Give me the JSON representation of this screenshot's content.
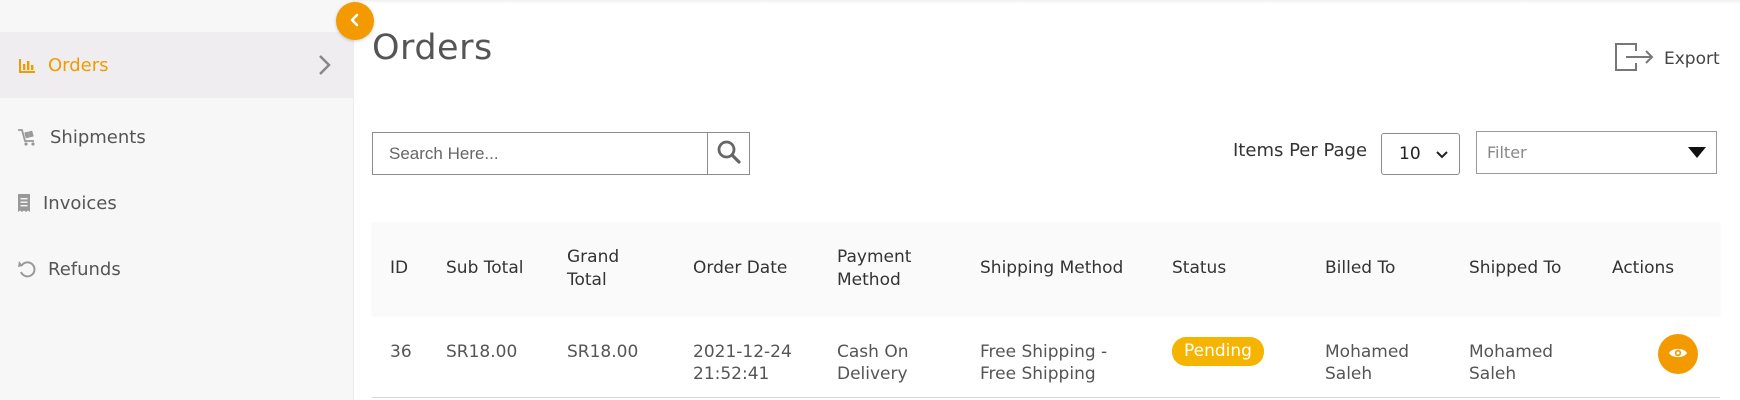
{
  "colors": {
    "accent": "#f29a00",
    "badge": "#f5b400"
  },
  "sidebar": {
    "items": [
      {
        "label": "Orders",
        "icon": "bar-chart-icon",
        "active": true
      },
      {
        "label": "Shipments",
        "icon": "cart-icon",
        "active": false
      },
      {
        "label": "Invoices",
        "icon": "receipt-icon",
        "active": false
      },
      {
        "label": "Refunds",
        "icon": "undo-icon",
        "active": false
      }
    ],
    "collapse_icon": "chevron-left-icon"
  },
  "header": {
    "title": "Orders",
    "export_label": "Export",
    "export_icon": "export-icon"
  },
  "toolbar": {
    "search_placeholder": "Search Here...",
    "search_value": "",
    "items_per_page_label": "Items Per Page",
    "items_per_page_value": "10",
    "filter_placeholder": "Filter"
  },
  "table": {
    "columns": [
      "ID",
      "Sub Total",
      "Grand Total",
      "Order Date",
      "Payment Method",
      "Shipping Method",
      "Status",
      "Billed To",
      "Shipped To",
      "Actions"
    ],
    "header_lines": {
      "grand_total": [
        "Grand",
        "Total"
      ],
      "payment_method": [
        "Payment",
        "Method"
      ]
    },
    "rows": [
      {
        "id": "36",
        "sub_total": "SR18.00",
        "grand_total": "SR18.00",
        "order_date": [
          "2021-12-24",
          "21:52:41"
        ],
        "payment_method": [
          "Cash On",
          "Delivery"
        ],
        "shipping_method": [
          "Free Shipping -",
          "Free Shipping"
        ],
        "status": "Pending",
        "billed_to": [
          "Mohamed",
          "Saleh"
        ],
        "shipped_to": [
          "Mohamed",
          "Saleh"
        ],
        "action_icon": "eye-icon"
      }
    ]
  }
}
